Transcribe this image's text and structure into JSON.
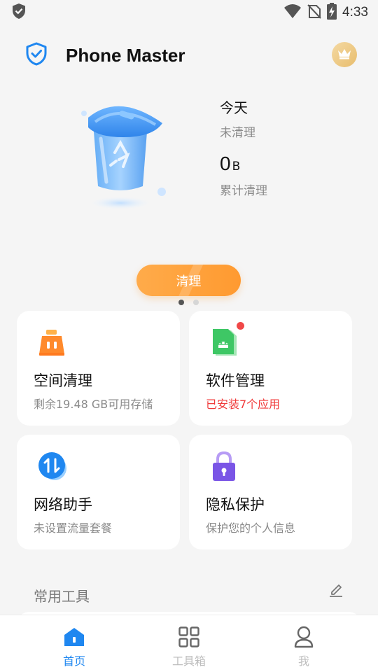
{
  "status_bar": {
    "time": "4:33"
  },
  "app_bar": {
    "title": "Phone Master"
  },
  "hero": {
    "today_label": "今天",
    "today_status": "未清理",
    "total_value": "0",
    "total_unit": "B",
    "total_label": "累计清理",
    "clean_button": "清理"
  },
  "cards": [
    {
      "title": "空间清理",
      "desc": "剩余19.48 GB可用存储"
    },
    {
      "title": "软件管理",
      "desc": "已安装7个应用"
    },
    {
      "title": "网络助手",
      "desc": "未设置流量套餐"
    },
    {
      "title": "隐私保护",
      "desc": "保护您的个人信息"
    }
  ],
  "tools_section": {
    "title": "常用工具"
  },
  "bottom_nav": [
    {
      "label": "首页"
    },
    {
      "label": "工具箱"
    },
    {
      "label": "我"
    }
  ],
  "colors": {
    "accent": "#1f87f0",
    "orange": "#ff9a30",
    "alert_red": "#f03a3a"
  }
}
